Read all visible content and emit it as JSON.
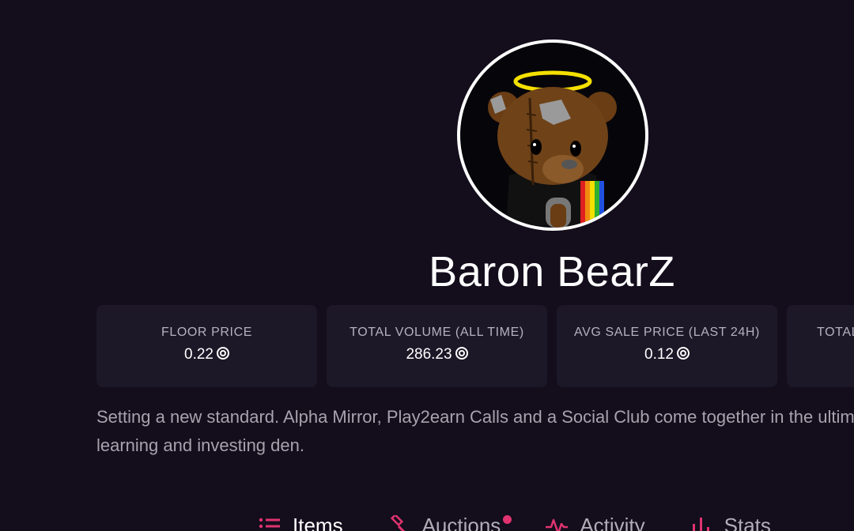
{
  "collection": {
    "name": "Baron BearZ",
    "description": "Setting a new standard. Alpha Mirror, Play2earn Calls and a Social Club come together in the ultimate learning and investing den."
  },
  "stats": [
    {
      "label": "FLOOR PRICE",
      "value": "0.22"
    },
    {
      "label": "TOTAL VOLUME (ALL TIME)",
      "value": "286.23"
    },
    {
      "label": "AVG SALE PRICE (LAST 24H)",
      "value": "0.12"
    },
    {
      "label": "TOTAL",
      "value": ""
    }
  ],
  "tabs": [
    {
      "label": "Items",
      "icon": "list-icon",
      "active": true
    },
    {
      "label": "Auctions",
      "icon": "gavel-icon",
      "notification": true
    },
    {
      "label": "Activity",
      "icon": "activity-icon"
    },
    {
      "label": "Stats",
      "icon": "bar-chart-icon"
    }
  ],
  "colors": {
    "background": "#130d1c",
    "card": "#1c1827",
    "accent": "#e0336f",
    "halo": "#f4e000"
  }
}
